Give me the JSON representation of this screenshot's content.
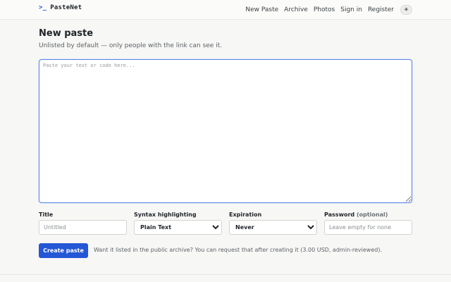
{
  "brand": {
    "prompt": ">_",
    "name": "PasteNet",
    "accent": "#2457d6"
  },
  "nav": {
    "items": [
      "New Paste",
      "Archive",
      "Photos",
      "Sign in",
      "Register"
    ],
    "theme_toggle": "☀"
  },
  "page": {
    "title": "New paste",
    "subtitle": "Unlisted by default — only people with the link can see it."
  },
  "paste": {
    "placeholder": "Paste your text or code here...",
    "value": ""
  },
  "form": {
    "title": {
      "label": "Title",
      "placeholder": "Untitled",
      "value": ""
    },
    "syntax": {
      "label": "Syntax highlighting",
      "selected": "Plain Text"
    },
    "expiration": {
      "label": "Expiration",
      "selected": "Never"
    },
    "password": {
      "label": "Password",
      "optional": "(optional)",
      "placeholder": "Leave empty for none"
    }
  },
  "actions": {
    "create_label": "Create paste",
    "hint": "Want it listed in the public archive? You can request that after creating it (3.00 USD, admin-reviewed)."
  }
}
